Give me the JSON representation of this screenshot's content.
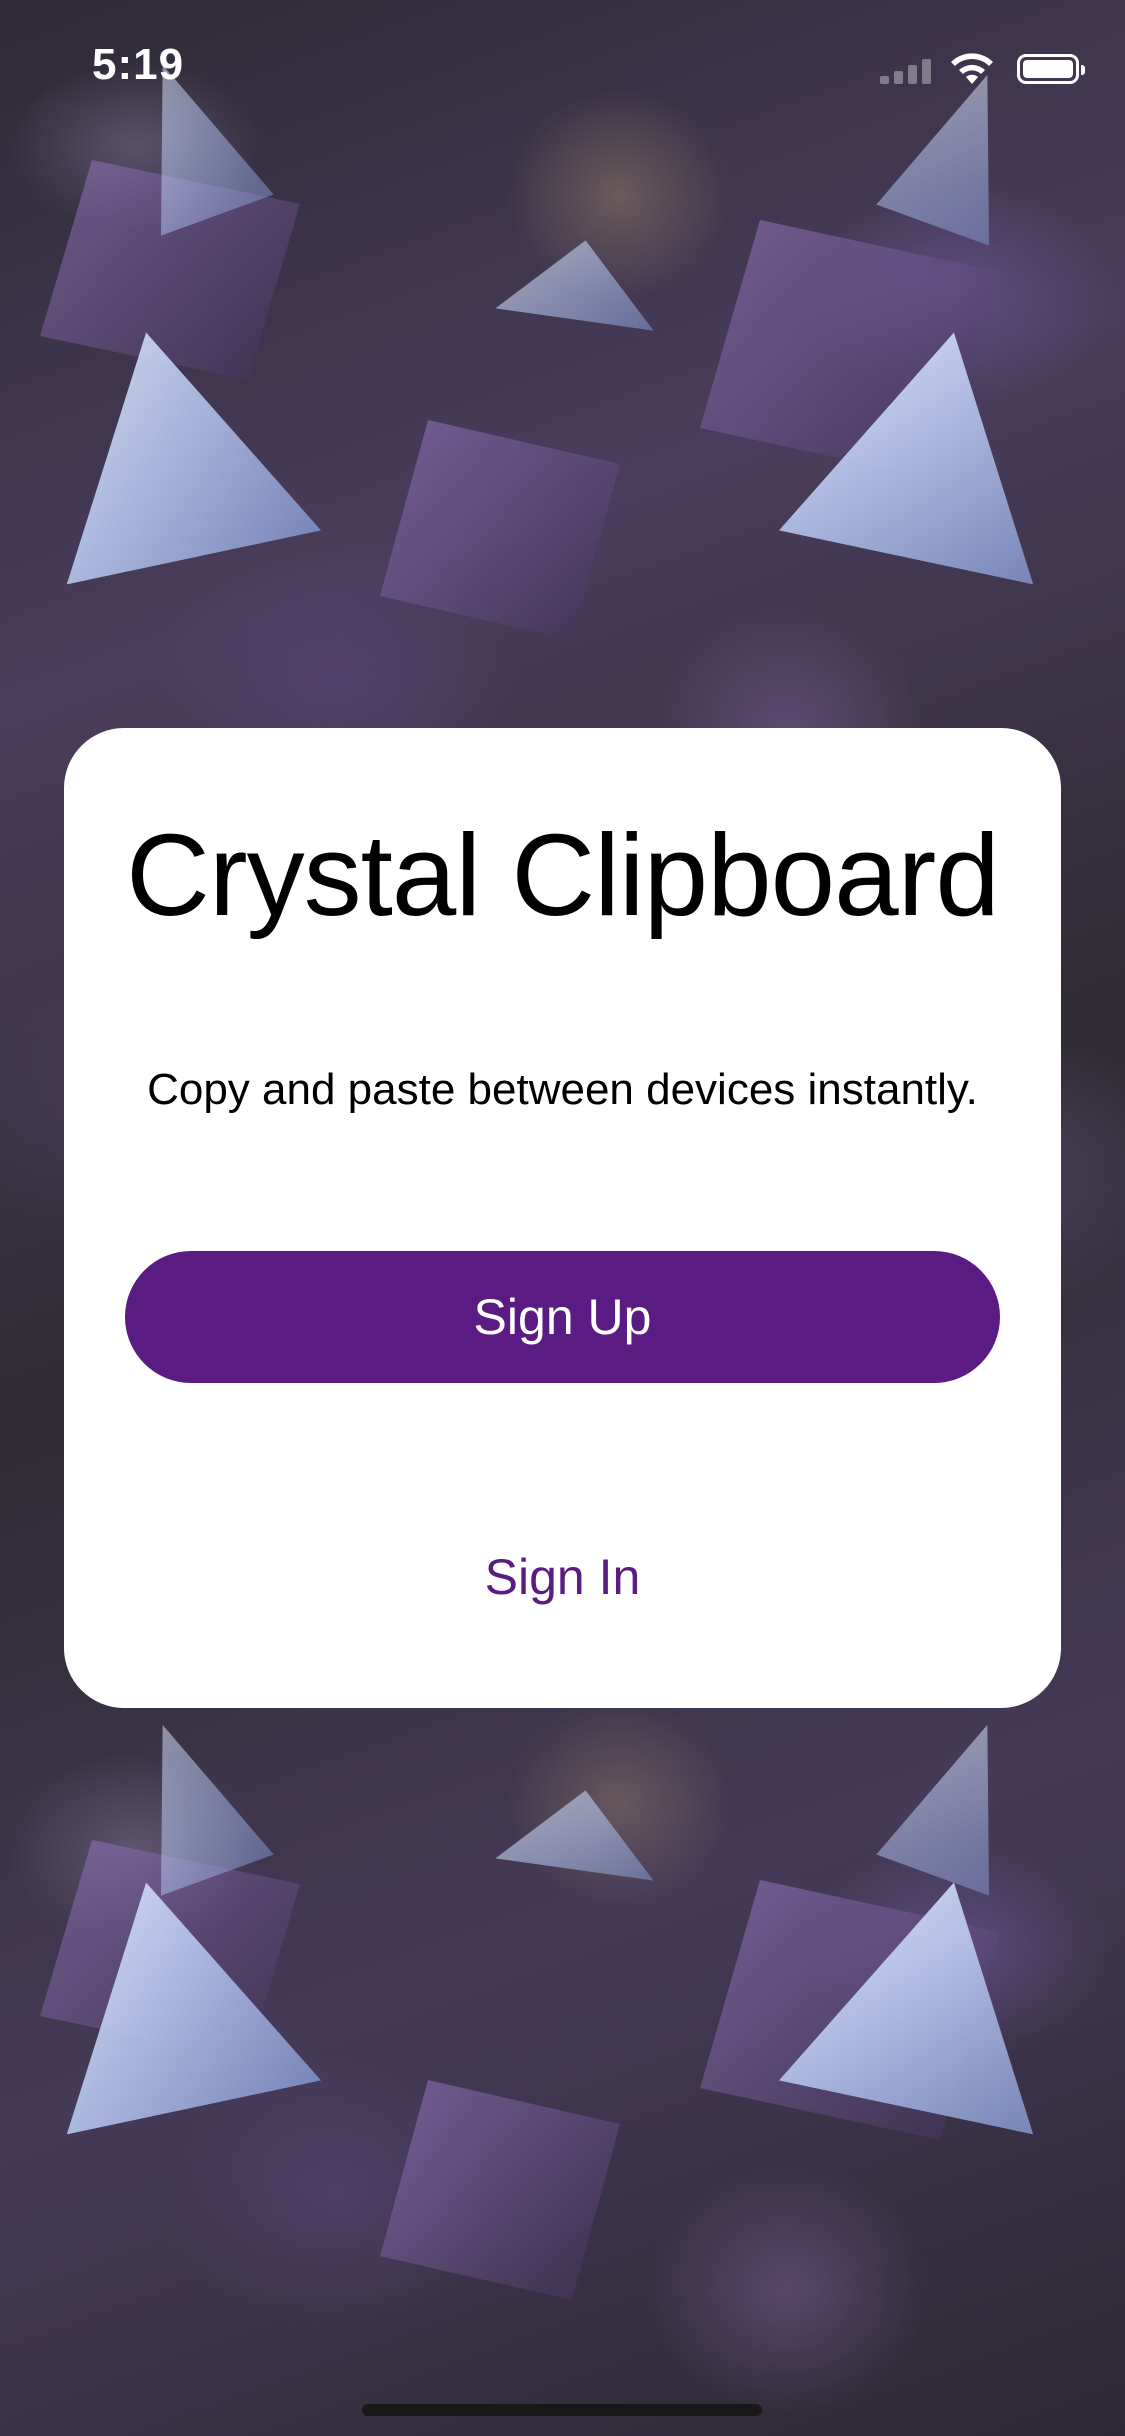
{
  "status_bar": {
    "time": "5:19",
    "icons": [
      "cellular-signal-icon",
      "wifi-icon",
      "battery-icon"
    ]
  },
  "card": {
    "title": "Crystal Clipboard",
    "subtitle": "Copy and paste between devices instantly.",
    "sign_up_label": "Sign Up",
    "sign_in_label": "Sign In"
  },
  "colors": {
    "accent": "#5a1b82",
    "card_background": "#ffffff",
    "text": "#000000"
  }
}
